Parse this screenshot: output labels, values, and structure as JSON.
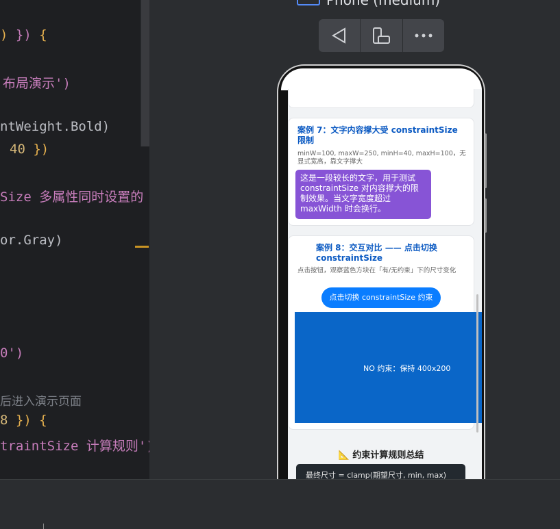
{
  "editor": {
    "lines": [
      {
        "pre": ") ",
        "mid": "})",
        "post": " {"
      },
      {
        "text": "布局演示')"
      },
      {
        "text": "ntWeight.Bold)"
      },
      {
        "num": "40",
        "post": " })"
      },
      {
        "prop": "Size",
        "text": " 多属性同时设置的"
      },
      {
        "text": "or.Gray)"
      },
      {
        "text": "0')"
      },
      {
        "comment": "后进入演示页面"
      },
      {
        "num": "8",
        "post": " }) {"
      },
      {
        "prop": "traintSize",
        "text": " 计算规则')"
      }
    ]
  },
  "preview": {
    "device_title": "Phone (medium)"
  },
  "toolbar": {
    "back_icon": "back-triangle-icon",
    "rotate_icon": "rotate-device-icon",
    "more_icon": "more-dots-icon"
  },
  "app": {
    "case7": {
      "title": "案例 7：文字内容撑大受 constraintSize 限制",
      "desc": "minW=100, maxW=250, minH=40, maxH=100，无显式宽高，靠文字撑大",
      "box_text": "这是一段较长的文字，用于测试 constraintSize 对内容撑大的限制效果。当文字宽度超过 maxWidth 时会换行。"
    },
    "case8": {
      "title": "案例 8：交互对比 —— 点击切换 constraintSize",
      "desc": "点击按钮，观察蓝色方块在「有/无约束」下的尺寸变化",
      "button": "点击切换 constraintSize 约束",
      "box_text": "NO 约束：保持 400x200"
    },
    "summary": {
      "title": "📐 约束计算规则总结",
      "formula": "最终尺寸 = clamp(期望尺寸, min, max)"
    }
  },
  "colors": {
    "accent_blue": "#0a7dff",
    "box_blue": "#0a66c8",
    "box_purple": "#8754d6",
    "pink": "#f2075f"
  }
}
